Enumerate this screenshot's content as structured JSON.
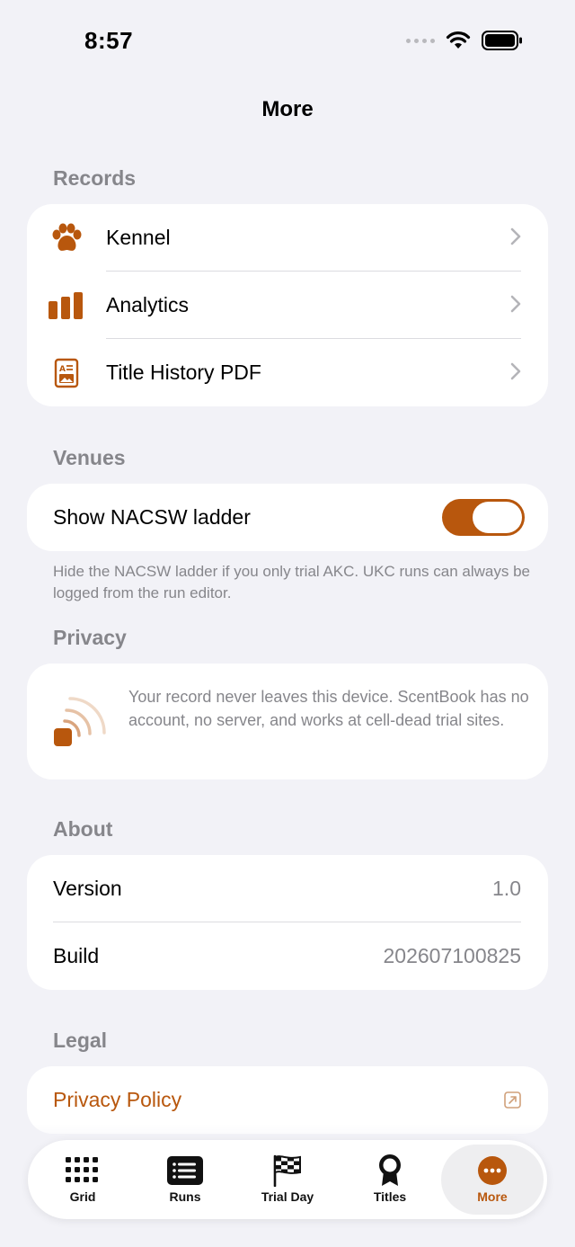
{
  "status": {
    "time": "8:57"
  },
  "nav": {
    "title": "More"
  },
  "records": {
    "header": "Records",
    "items": [
      {
        "label": "Kennel",
        "icon": "paw-icon"
      },
      {
        "label": "Analytics",
        "icon": "bar-chart-icon"
      },
      {
        "label": "Title History PDF",
        "icon": "document-icon"
      }
    ]
  },
  "venues": {
    "header": "Venues",
    "toggle_label": "Show NACSW ladder",
    "toggle_on": true,
    "footnote": "Hide the NACSW ladder if you only trial AKC. UKC runs can always be logged from the run editor."
  },
  "privacy": {
    "header": "Privacy",
    "text": "Your record never leaves this device. ScentBook has no account, no server, and works at cell-dead trial sites.",
    "icon": "offline-signal-icon"
  },
  "about": {
    "header": "About",
    "rows": [
      {
        "label": "Version",
        "value": "1.0"
      },
      {
        "label": "Build",
        "value": "202607100825"
      }
    ]
  },
  "legal": {
    "header": "Legal",
    "privacy_policy": "Privacy Policy"
  },
  "tabs": [
    {
      "label": "Grid",
      "icon": "grid-icon"
    },
    {
      "label": "Runs",
      "icon": "list-icon"
    },
    {
      "label": "Trial Day",
      "icon": "checkered-flag-icon"
    },
    {
      "label": "Titles",
      "icon": "ribbon-icon"
    },
    {
      "label": "More",
      "icon": "more-icon",
      "active": true
    }
  ],
  "colors": {
    "accent": "#b8570d",
    "background": "#f2f2f7",
    "secondary_text": "#86868b"
  }
}
